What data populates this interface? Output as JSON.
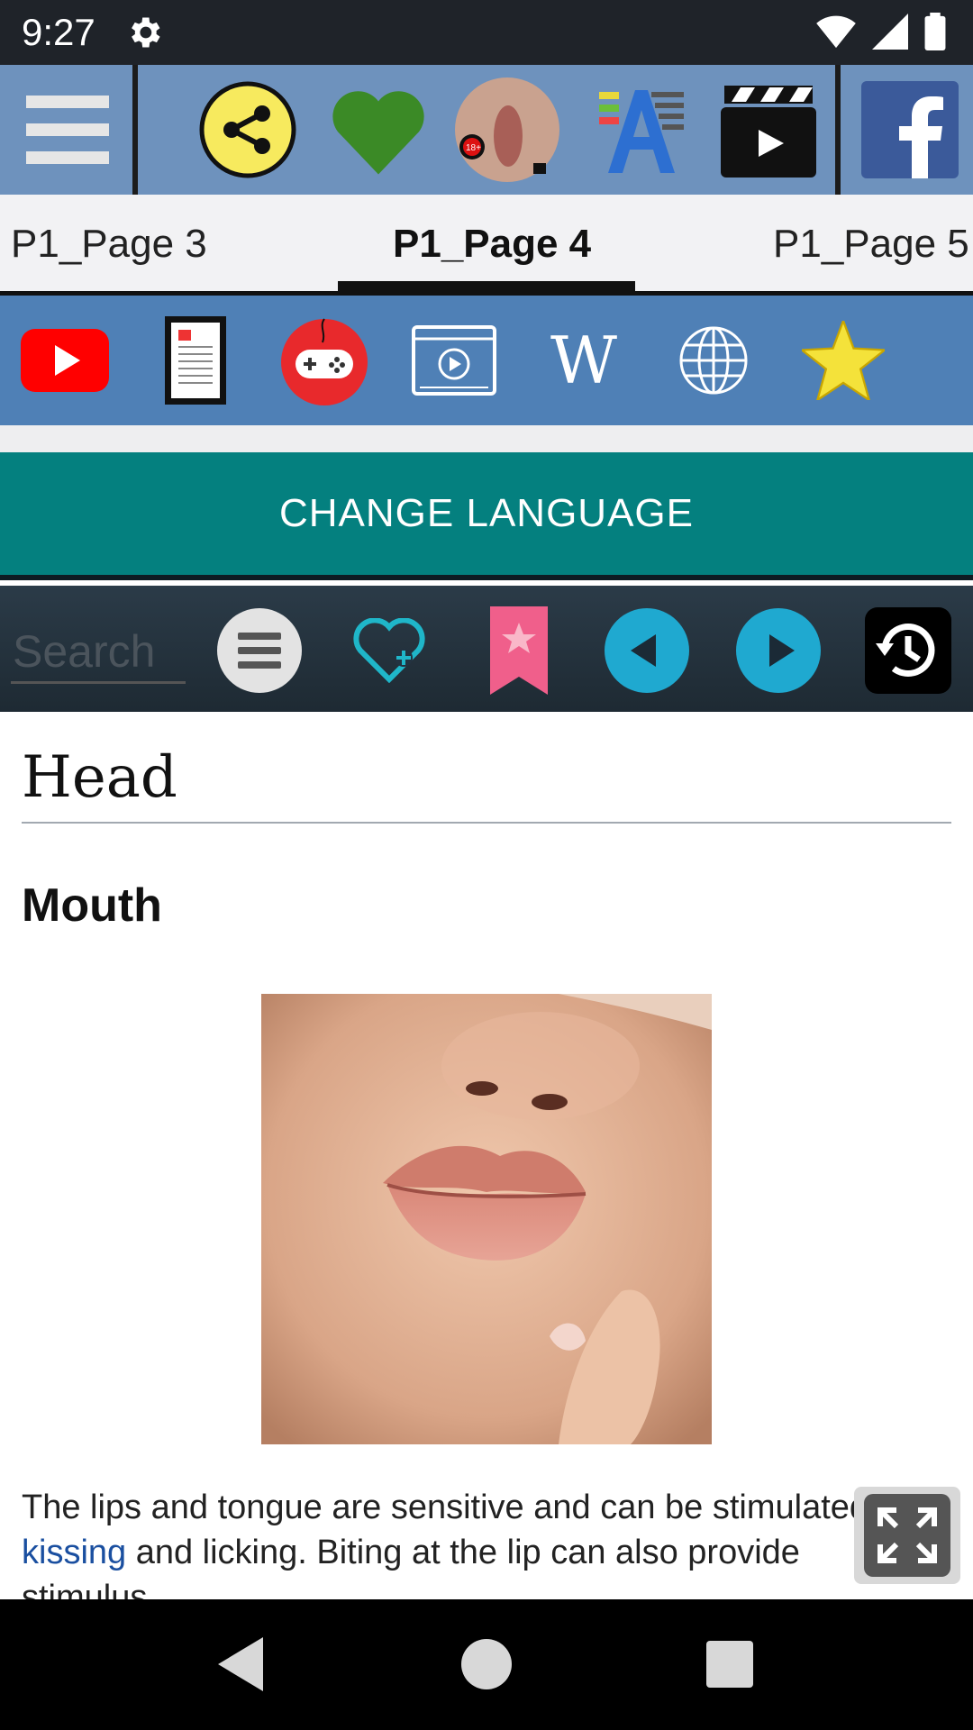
{
  "status": {
    "time": "9:27"
  },
  "tabs": [
    {
      "label": "P1_Page 3"
    },
    {
      "label": "P1_Page 4"
    },
    {
      "label": "P1_Page 5"
    }
  ],
  "active_tab": "P1_Page 4",
  "change_language_label": "CHANGE LANGUAGE",
  "search": {
    "placeholder": "Search"
  },
  "article": {
    "title": "Head",
    "section": "Mouth",
    "paragraph_before": "The lips and tongue are sensitive and can be stimulated by ",
    "paragraph_link": "kissing",
    "paragraph_after": " and licking. Biting at the lip can also provide stimulus."
  },
  "toolbar_icons": [
    "menu-icon",
    "share-icon",
    "heart-icon",
    "anatomy-thumbnail",
    "font-size-icon",
    "video-clapper-icon",
    "facebook-icon"
  ],
  "colors": {
    "toolbar": "#6e92bd",
    "apps_row": "#4f80b6",
    "change_language": "#04807f",
    "link": "#1a4fa0"
  }
}
